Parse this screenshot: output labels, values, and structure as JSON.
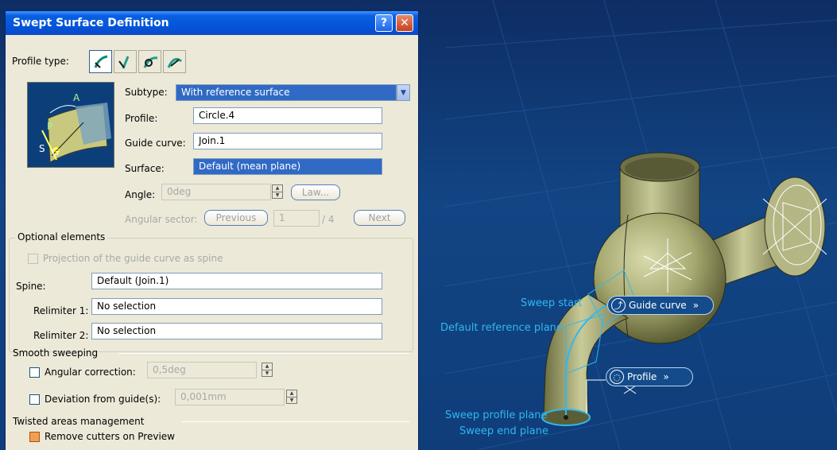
{
  "dialog": {
    "title": "Swept Surface Definition",
    "help_icon": "?",
    "close_icon": "✕",
    "profile_type_label": "Profile type:",
    "profile_types": [
      "explicit-icon",
      "line-icon",
      "circle-icon",
      "conic-icon"
    ],
    "subtype_label": "Subtype:",
    "subtype_value": "With reference surface",
    "profile_label": "Profile:",
    "profile_value": "Circle.4",
    "guide_curve_label": "Guide curve:",
    "guide_curve_value": "Join.1",
    "surface_label": "Surface:",
    "surface_value": "Default (mean plane)",
    "angle_label": "Angle:",
    "angle_value": "0deg",
    "law_button": "Law...",
    "angular_sector_label": "Angular sector:",
    "previous_button": "Previous",
    "sector_value": "1",
    "sector_total": "/ 4",
    "next_button": "Next",
    "optional_elements": {
      "title": "Optional elements",
      "projection_label": "Projection of the guide curve as spine",
      "spine_label": "Spine:",
      "spine_value": "Default (Join.1)",
      "relimiter1_label": "Relimiter 1:",
      "relimiter1_value": "No selection",
      "relimiter2_label": "Relimiter 2:",
      "relimiter2_value": "No selection"
    },
    "smooth_sweeping": {
      "title": "Smooth sweeping",
      "angular_correction_label": "Angular correction:",
      "angular_correction_value": "0,5deg",
      "deviation_label": "Deviation from guide(s):",
      "deviation_value": "0,001mm"
    },
    "twisted_areas": {
      "title": "Twisted areas management",
      "remove_cutters_label": "Remove cutters on Preview",
      "remove_cutters_checked": true
    },
    "diagram_labels": {
      "a": "A",
      "p": "P",
      "s": "S",
      "g": "G"
    }
  },
  "scene": {
    "sweep_start": "Sweep start",
    "default_reference_plane": "Default reference plane",
    "sweep_profile_plane": "Sweep profile plane",
    "sweep_end_plane": "Sweep end plane",
    "guide_curve_tag": "Guide curve",
    "profile_tag": "Profile",
    "chevron": "»",
    "colors": {
      "background": "#0f3d7a",
      "body": "#a9ab7a",
      "highlight": "#2fb8f0"
    }
  }
}
